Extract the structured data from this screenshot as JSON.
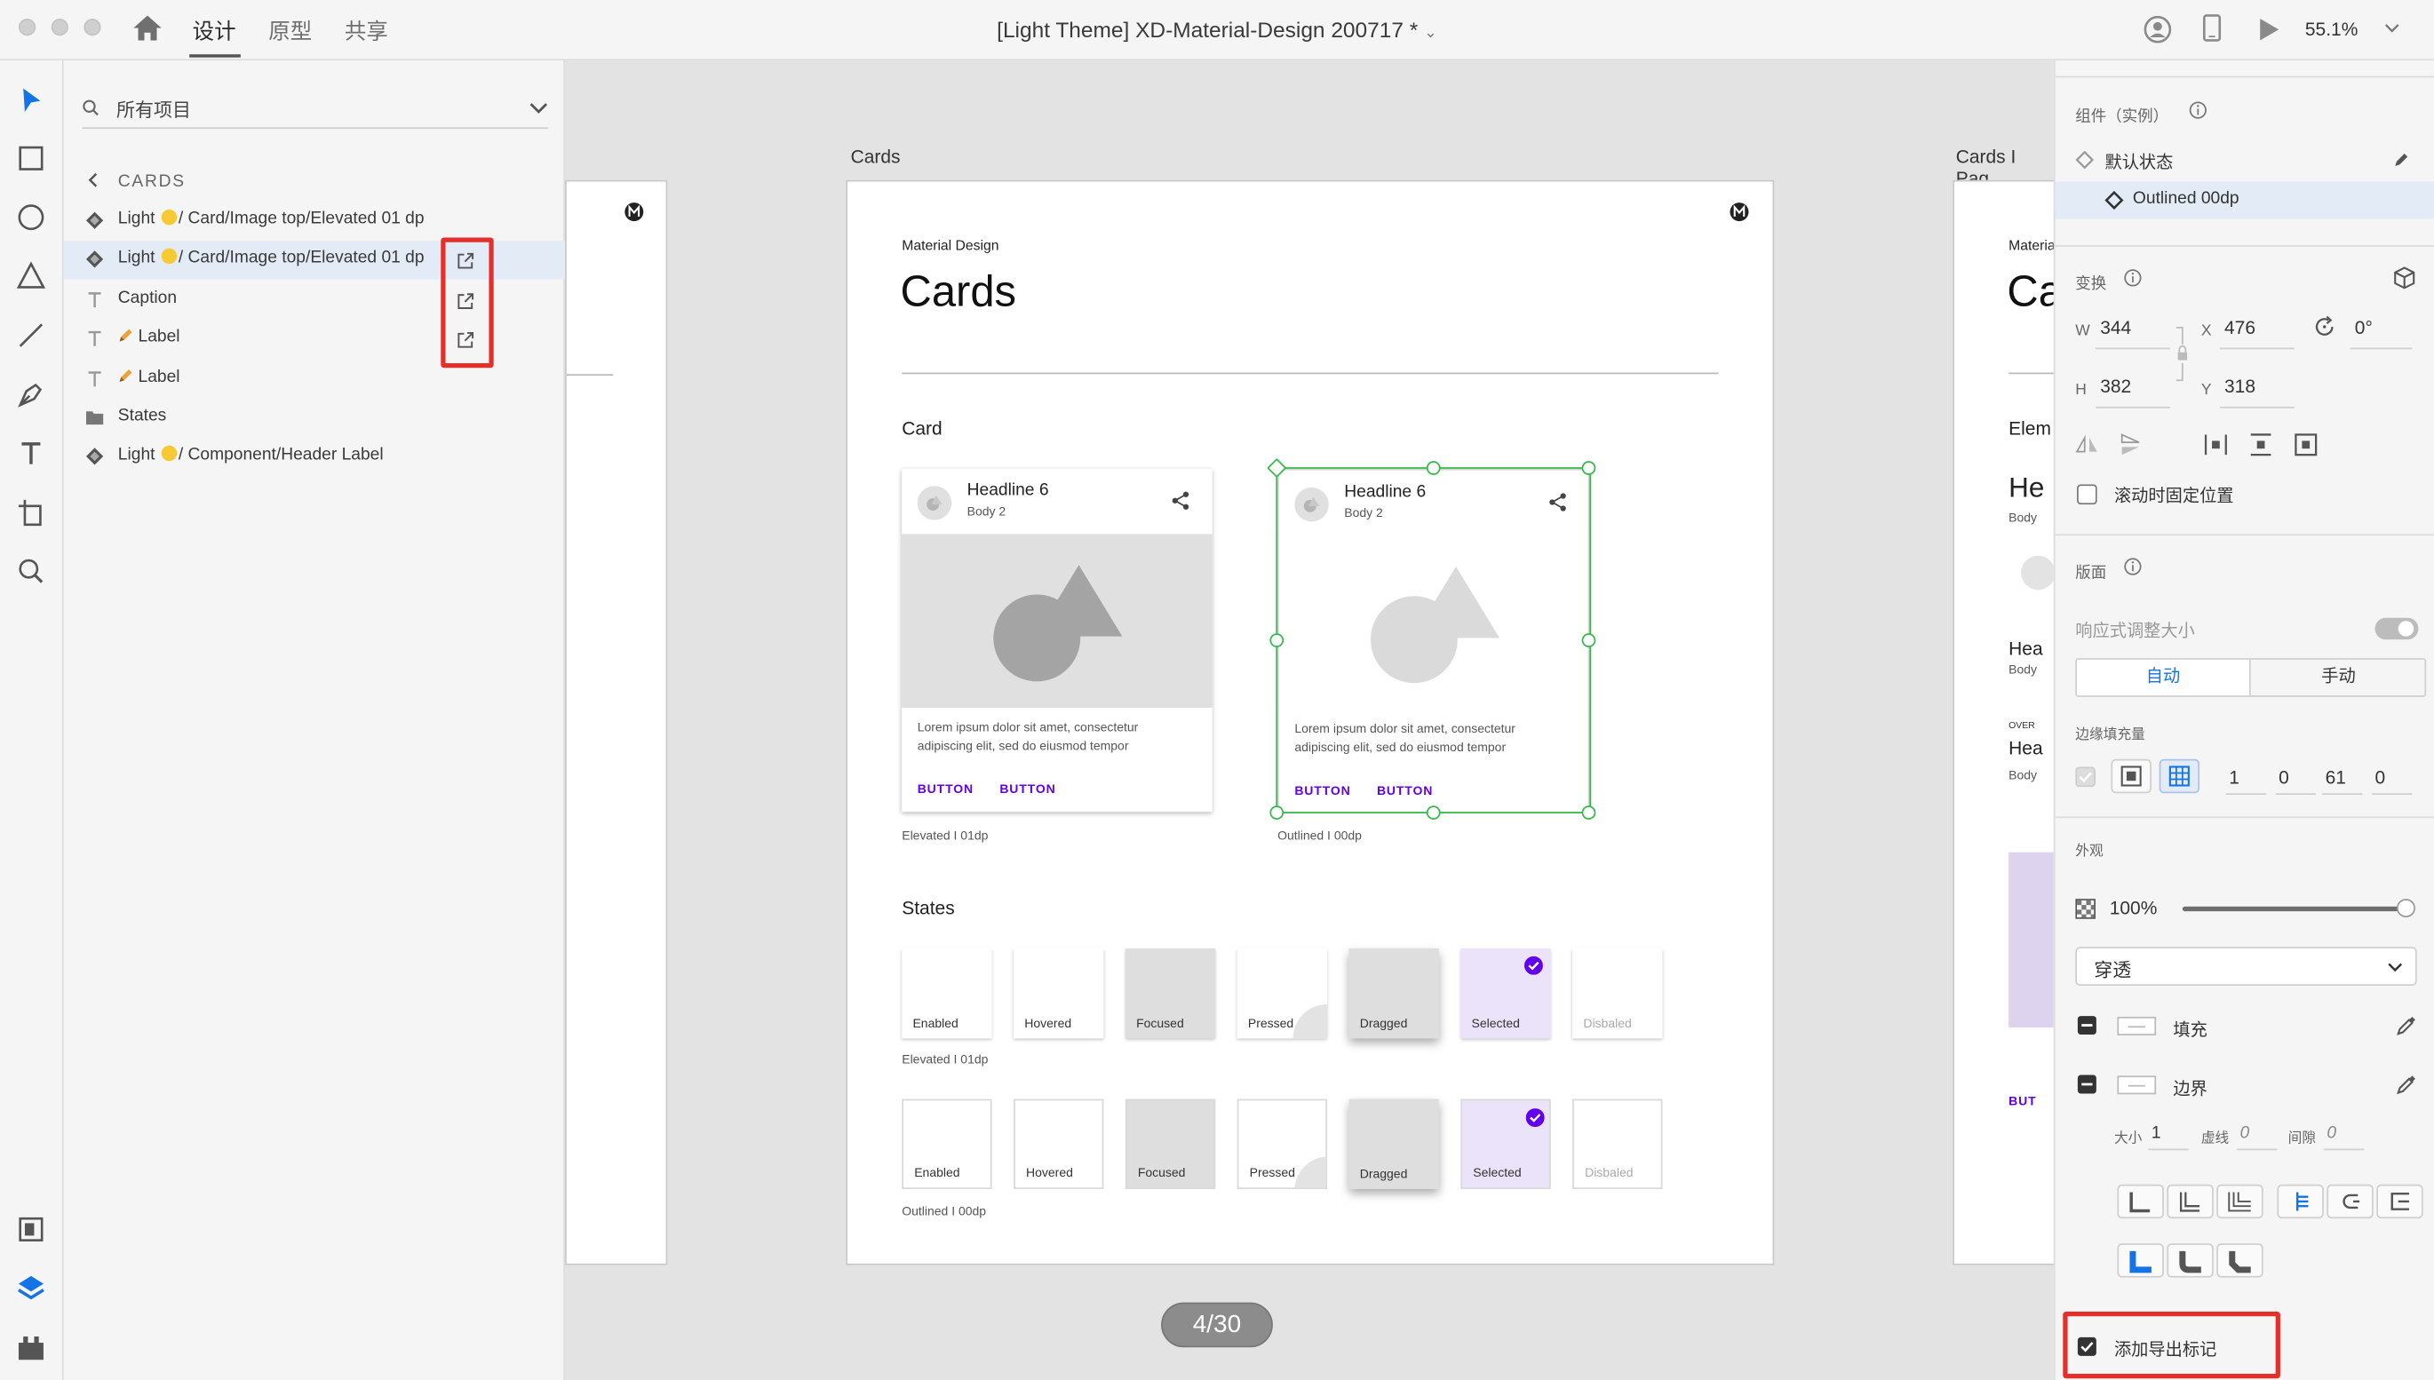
{
  "app": {
    "nav_tabs": [
      "设计",
      "原型",
      "共享"
    ],
    "document_title": "[Light Theme] XD-Material-Design 200717 *",
    "zoom": "55.1%"
  },
  "layers": {
    "search_placeholder": "所有项目",
    "breadcrumb": "CARDS",
    "items": [
      {
        "label": "Light 🟡/ Card/Image top/Elevated 01 dp",
        "prefix": "Light ",
        "suffix": "/ Card/Image top/Elevated 01 dp",
        "icon": "component-icon",
        "selected": false
      },
      {
        "label": "Light 🟡/ Card/Image top/Elevated 01 dp",
        "prefix": "Light ",
        "suffix": "/ Card/Image top/Elevated 01 dp",
        "icon": "component-icon",
        "selected": true
      },
      {
        "label": "Caption",
        "icon": "text-icon"
      },
      {
        "label": "Label",
        "icon": "text-icon"
      },
      {
        "label": "Label",
        "icon": "text-icon"
      },
      {
        "label": "States",
        "icon": "folder-icon"
      },
      {
        "label": "Light 🟡/ Component/Header Label",
        "prefix": "Light ",
        "suffix": "/ Component/Header Label",
        "icon": "component-icon"
      }
    ]
  },
  "canvas": {
    "artboard_label": "Cards",
    "right_artboard_label": "Cards I Pag",
    "page_counter": "4/30",
    "artboard": {
      "eyebrow": "Material Design",
      "title": "Cards",
      "card_section": "Card",
      "states_section": "States",
      "cards": [
        {
          "headline": "Headline 6",
          "sub": "Body 2",
          "body_line1": "Lorem ipsum dolor sit amet, consectetur",
          "body_line2": "adipiscing elit, sed do eiusmod tempor",
          "btn1": "BUTTON",
          "btn2": "BUTTON",
          "caption": "Elevated I 01dp"
        },
        {
          "headline": "Headline 6",
          "sub": "Body 2",
          "body_line1": "Lorem ipsum dolor sit amet, consectetur",
          "body_line2": "adipiscing elit, sed do eiusmod tempor",
          "btn1": "BUTTON",
          "btn2": "BUTTON",
          "caption": "Outlined I 00dp"
        }
      ],
      "state_labels": [
        "Enabled",
        "Hovered",
        "Focused",
        "Pressed",
        "Dragged",
        "Selected",
        "Disbaled"
      ],
      "states_caption_elevated": "Elevated I 01dp",
      "states_caption_outlined": "Outlined I 00dp"
    },
    "right_peek": {
      "eyebrow": "Materia",
      "title": "Ca",
      "section": "Elem",
      "h1": "He",
      "b1": "Body",
      "h2": "Hea",
      "b2": "Body",
      "over": "OVER",
      "h3": "Hea",
      "b3": "Body",
      "btn": "BUT"
    }
  },
  "properties": {
    "component_header": "组件（实例）",
    "default_state": "默认状态",
    "current_state": "Outlined 00dp",
    "transform_header": "变换",
    "w_label": "W",
    "w": "344",
    "x_label": "X",
    "x": "476",
    "rotation": "0°",
    "h_label": "H",
    "h": "382",
    "y_label": "Y",
    "y": "318",
    "fix_position": "滚动时固定位置",
    "layout_header": "版面",
    "responsive": "响应式调整大小",
    "auto": "自动",
    "manual": "手动",
    "padding_header": "边缘填充量",
    "padding": [
      "1",
      "0",
      "61",
      "0"
    ],
    "appearance_header": "外观",
    "opacity": "100%",
    "opacity_value": 1.0,
    "blend_mode": "穿透",
    "fill_label": "填充",
    "border_label": "边界",
    "size_label": "大小",
    "size": "1",
    "dash_label": "虚线",
    "dash": "0",
    "gap_label": "间隙",
    "gap": "0",
    "export_mark": "添加导出标记"
  },
  "colors": {
    "accent": "#1473e6",
    "selection": "#35b84a",
    "purple": "#6200ee",
    "highlight": "#e3302b"
  }
}
